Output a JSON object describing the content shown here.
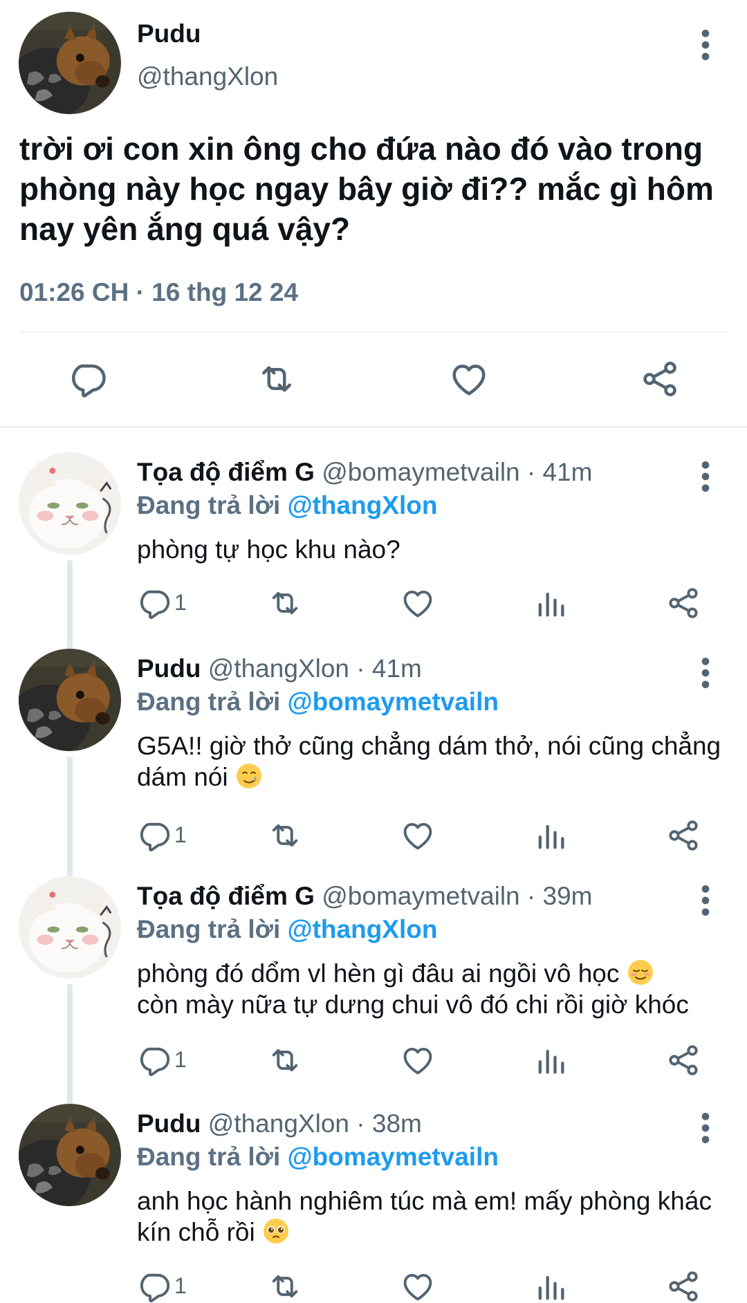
{
  "main_tweet": {
    "name": "Pudu",
    "handle": "@thangXlon",
    "text": "trời ơi con xin ông cho đứa nào đó vào trong phòng này học ngay bây giờ đi?? mắc gì hôm nay yên ắng quá vậy?",
    "timestamp": "01:26 CH · 16 thg 12 24",
    "avatar_icon": "pudu-deer-avatar"
  },
  "replies": [
    {
      "name": "Tọa độ điểm G",
      "handle": "@bomaymetvailn",
      "separator": "·",
      "time": "41m",
      "replying_prefix": "Đang trả lời",
      "replying_to": "@thangXlon",
      "text": "phòng tự học khu nào?",
      "emoji": "",
      "reply_count": "1",
      "avatar_icon": "white-cat-avatar"
    },
    {
      "name": "Pudu",
      "handle": "@thangXlon",
      "separator": "·",
      "time": "41m",
      "replying_prefix": "Đang trả lời",
      "replying_to": "@bomaymetvailn",
      "text": "G5A!! giờ thở cũng chẳng dám thở, nói cũng chẳng dám nói ",
      "emoji": "crying-smile-emoji",
      "reply_count": "1",
      "avatar_icon": "pudu-deer-avatar"
    },
    {
      "name": "Tọa độ điểm G",
      "handle": "@bomaymetvailn",
      "separator": "·",
      "time": "39m",
      "replying_prefix": "Đang trả lời",
      "replying_to": "@thangXlon",
      "text": "phòng đó dổm vl hèn gì đâu ai ngồi vô học ",
      "text2": "còn mày nữa tự dưng chui vô đó chi rồi giờ khóc",
      "emoji": "relieved-smile-emoji",
      "reply_count": "1",
      "avatar_icon": "white-cat-avatar"
    },
    {
      "name": "Pudu",
      "handle": "@thangXlon",
      "separator": "·",
      "time": "38m",
      "replying_prefix": "Đang trả lời",
      "replying_to": "@bomaymetvailn",
      "text": "anh học hành nghiêm túc mà em! mấy phòng khác kín chỗ rồi ",
      "emoji": "pleading-face-emoji",
      "reply_count": "1",
      "avatar_icon": "pudu-deer-avatar"
    }
  ],
  "colors": {
    "accent": "#1d9bf0",
    "secondary_text": "#536471",
    "text": "#0f1419",
    "divider": "#eff3f4"
  }
}
